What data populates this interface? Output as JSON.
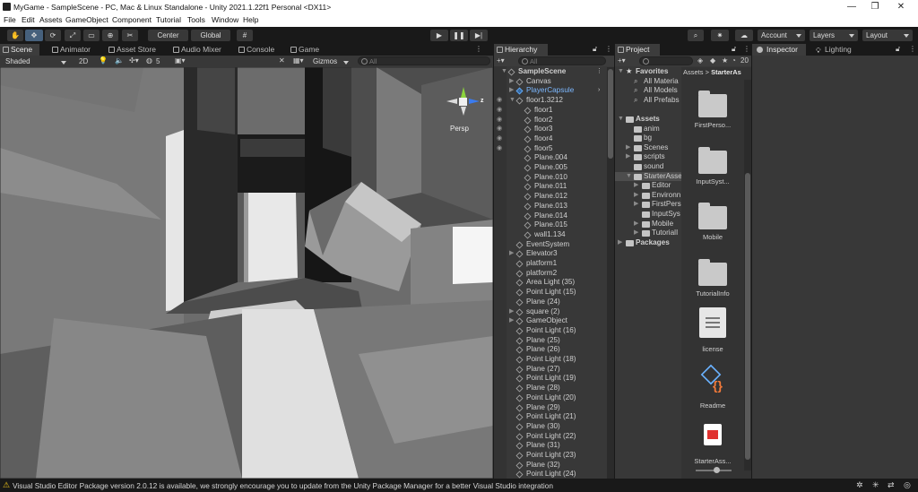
{
  "window": {
    "title": "MyGame - SampleScene - PC, Mac & Linux Standalone - Unity 2021.1.22f1 Personal <DX11>",
    "controls": [
      "—",
      "❐",
      "✕"
    ]
  },
  "menu": [
    "File",
    "Edit",
    "Assets",
    "GameObject",
    "Component",
    "Tutorial",
    "Tools",
    "Window",
    "Help"
  ],
  "toolbar": {
    "pivot": "Center",
    "space": "Global",
    "account": "Account",
    "layers": "Layers",
    "layout": "Layout"
  },
  "scene_tabs": [
    "Scene",
    "Animator",
    "Asset Store",
    "Audio Mixer",
    "Console",
    "Game"
  ],
  "scene_toolbar": {
    "shading": "Shaded",
    "mode2d": "2D",
    "fx_count": "5",
    "gizmos": "Gizmos",
    "search_placeholder": "All",
    "persp": "Persp"
  },
  "hierarchy": {
    "tab": "Hierarchy",
    "search_placeholder": "All",
    "rows": [
      {
        "label": "SampleScene",
        "depth": 0,
        "arrow": "▼",
        "bold": true
      },
      {
        "label": "Canvas",
        "depth": 1,
        "arrow": "▶"
      },
      {
        "label": "PlayerCapsule",
        "depth": 1,
        "arrow": "▶",
        "prefab": true
      },
      {
        "label": "floor1.3212",
        "depth": 1,
        "arrow": "▼"
      },
      {
        "label": "floor1",
        "depth": 2
      },
      {
        "label": "floor2",
        "depth": 2
      },
      {
        "label": "floor3",
        "depth": 2
      },
      {
        "label": "floor4",
        "depth": 2
      },
      {
        "label": "floor5",
        "depth": 2
      },
      {
        "label": "Plane.004",
        "depth": 2
      },
      {
        "label": "Plane.005",
        "depth": 2
      },
      {
        "label": "Plane.010",
        "depth": 2
      },
      {
        "label": "Plane.011",
        "depth": 2
      },
      {
        "label": "Plane.012",
        "depth": 2
      },
      {
        "label": "Plane.013",
        "depth": 2
      },
      {
        "label": "Plane.014",
        "depth": 2
      },
      {
        "label": "Plane.015",
        "depth": 2
      },
      {
        "label": "wall1.134",
        "depth": 2
      },
      {
        "label": "EventSystem",
        "depth": 1
      },
      {
        "label": "Elevator3",
        "depth": 1,
        "arrow": "▶"
      },
      {
        "label": "platform1",
        "depth": 1
      },
      {
        "label": "platform2",
        "depth": 1
      },
      {
        "label": "Area Light (35)",
        "depth": 1
      },
      {
        "label": "Point Light (15)",
        "depth": 1
      },
      {
        "label": "Plane (24)",
        "depth": 1
      },
      {
        "label": "square (2)",
        "depth": 1,
        "arrow": "▶"
      },
      {
        "label": "GameObject",
        "depth": 1,
        "arrow": "▶"
      },
      {
        "label": "Point Light (16)",
        "depth": 1
      },
      {
        "label": "Plane (25)",
        "depth": 1
      },
      {
        "label": "Plane (26)",
        "depth": 1
      },
      {
        "label": "Point Light (18)",
        "depth": 1
      },
      {
        "label": "Plane (27)",
        "depth": 1
      },
      {
        "label": "Point Light (19)",
        "depth": 1
      },
      {
        "label": "Plane (28)",
        "depth": 1
      },
      {
        "label": "Point Light (20)",
        "depth": 1
      },
      {
        "label": "Plane (29)",
        "depth": 1
      },
      {
        "label": "Point Light (21)",
        "depth": 1
      },
      {
        "label": "Plane (30)",
        "depth": 1
      },
      {
        "label": "Point Light (22)",
        "depth": 1
      },
      {
        "label": "Plane (31)",
        "depth": 1
      },
      {
        "label": "Point Light (23)",
        "depth": 1
      },
      {
        "label": "Plane (32)",
        "depth": 1
      },
      {
        "label": "Point Light (24)",
        "depth": 1
      }
    ]
  },
  "project": {
    "tab": "Project",
    "asset_count": "20",
    "breadcrumb": "Assets",
    "breadcrumb_current": "StarterAs",
    "tree": [
      {
        "label": "Favorites",
        "depth": 0,
        "arrow": "▼",
        "bold": true,
        "kind": "star"
      },
      {
        "label": "All Materia",
        "depth": 1,
        "kind": "search"
      },
      {
        "label": "All Models",
        "depth": 1,
        "kind": "search"
      },
      {
        "label": "All Prefabs",
        "depth": 1,
        "kind": "search"
      },
      {
        "label": "",
        "depth": 0,
        "kind": "blank"
      },
      {
        "label": "Assets",
        "depth": 0,
        "arrow": "▼",
        "bold": true,
        "kind": "folder"
      },
      {
        "label": "anim",
        "depth": 1,
        "kind": "folder"
      },
      {
        "label": "bg",
        "depth": 1,
        "kind": "folder"
      },
      {
        "label": "Scenes",
        "depth": 1,
        "arrow": "▶",
        "kind": "folder"
      },
      {
        "label": "scripts",
        "depth": 1,
        "arrow": "▶",
        "kind": "folder"
      },
      {
        "label": "sound",
        "depth": 1,
        "kind": "folder"
      },
      {
        "label": "StarterAsse",
        "depth": 1,
        "arrow": "▼",
        "kind": "folder",
        "selected": true
      },
      {
        "label": "Editor",
        "depth": 2,
        "arrow": "▶",
        "kind": "folder"
      },
      {
        "label": "Environn",
        "depth": 2,
        "arrow": "▶",
        "kind": "folder"
      },
      {
        "label": "FirstPers",
        "depth": 2,
        "arrow": "▶",
        "kind": "folder"
      },
      {
        "label": "InputSys",
        "depth": 2,
        "kind": "folder"
      },
      {
        "label": "Mobile",
        "depth": 2,
        "arrow": "▶",
        "kind": "folder"
      },
      {
        "label": "TutorialI",
        "depth": 2,
        "arrow": "▶",
        "kind": "folder"
      },
      {
        "label": "Packages",
        "depth": 0,
        "arrow": "▶",
        "bold": true,
        "kind": "folder"
      }
    ],
    "assets": [
      {
        "label": "FirstPerso...",
        "kind": "folder"
      },
      {
        "label": "InputSyst...",
        "kind": "folder"
      },
      {
        "label": "Mobile",
        "kind": "folder"
      },
      {
        "label": "TutorialInfo",
        "kind": "folder"
      },
      {
        "label": "license",
        "kind": "doc"
      },
      {
        "label": "Readme",
        "kind": "script"
      },
      {
        "label": "StarterAss...",
        "kind": "pdf"
      }
    ]
  },
  "inspector": {
    "tab": "Inspector",
    "lighting_tab": "Lighting"
  },
  "status": {
    "message": "Visual Studio Editor Package version 2.0.12 is available, we strongly encourage you to update from the Unity Package Manager for a better Visual Studio integration"
  },
  "colors": {
    "accent": "#46607c",
    "warning": "#f0c419",
    "prefab": "#7cb8ff"
  }
}
